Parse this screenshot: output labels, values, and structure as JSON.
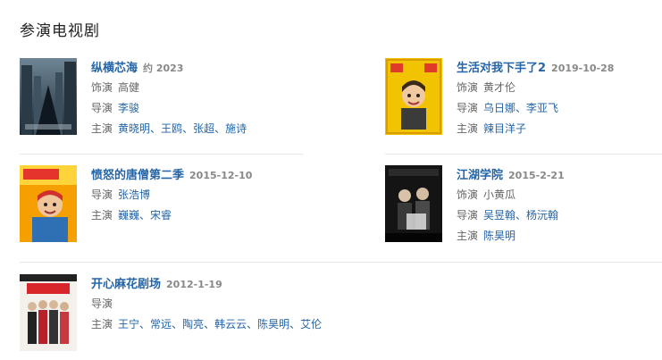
{
  "section": {
    "title": "参演电视剧"
  },
  "dramas": [
    {
      "title": "纵横芯海",
      "meta": "约 2023",
      "role_label": "饰演",
      "role": "高健",
      "director_label": "导演",
      "directors": [
        "李骏"
      ],
      "cast_label": "主演",
      "cast": [
        "黄晓明",
        "王鸥",
        "张超",
        "施诗"
      ]
    },
    {
      "title": "生活对我下手了2",
      "meta": "2019-10-28",
      "role_label": "饰演",
      "role": "黄才伦",
      "director_label": "导演",
      "directors": [
        "乌日娜",
        "李亚飞"
      ],
      "cast_label": "主演",
      "cast": [
        "辣目洋子"
      ]
    },
    {
      "title": "愤怒的唐僧第二季",
      "meta": "2015-12-10",
      "director_label": "导演",
      "directors": [
        "张浩博"
      ],
      "cast_label": "主演",
      "cast": [
        "巍巍",
        "宋睿"
      ]
    },
    {
      "title": "江湖学院",
      "meta": "2015-2-21",
      "role_label": "饰演",
      "role": "小黄瓜",
      "director_label": "导演",
      "directors": [
        "吴昱翰",
        "杨沅翰"
      ],
      "cast_label": "主演",
      "cast": [
        "陈昊明"
      ]
    },
    {
      "title": "开心麻花剧场",
      "meta": "2012-1-19",
      "director_label": "导演",
      "directors": [],
      "cast_label": "主演",
      "cast": [
        "王宁",
        "常远",
        "陶亮",
        "韩云云",
        "陈昊明",
        "艾伦"
      ]
    }
  ],
  "separator": "、"
}
